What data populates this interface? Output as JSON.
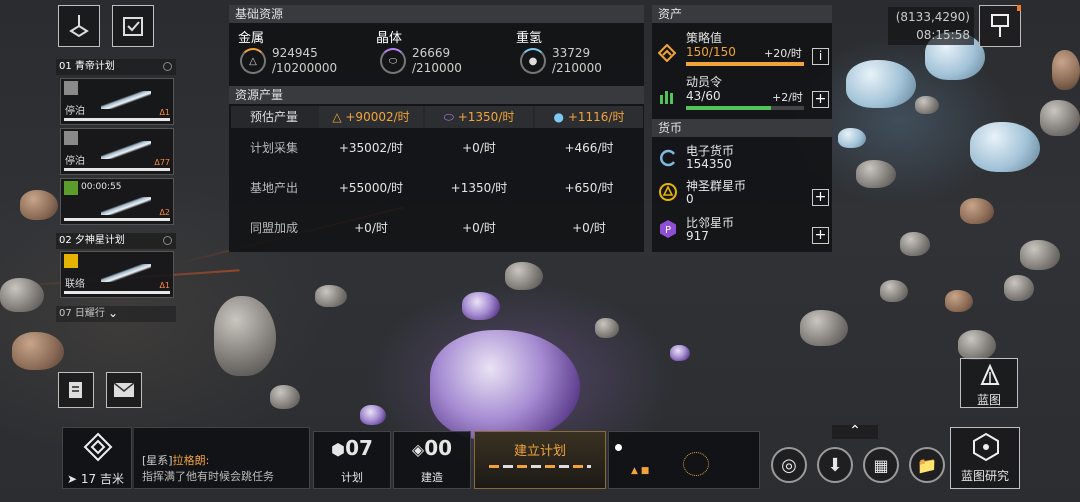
{
  "top_left": {
    "fleets": [
      {
        "index": "01",
        "name": "青帝计划"
      },
      {
        "index": "02",
        "name": "夕神星计划"
      },
      {
        "index": "07",
        "name": "日耀行"
      }
    ],
    "cards": [
      {
        "state": "停泊",
        "warn": "Δ1"
      },
      {
        "state": "停泊",
        "warn": "Δ77"
      },
      {
        "timer": "00:00:55",
        "warn": "Δ2"
      },
      {
        "state": "联络",
        "warn": "Δ1"
      }
    ]
  },
  "resources": {
    "header": "基础资源",
    "items": [
      {
        "name": "金属",
        "current": "924945",
        "max": "/10200000"
      },
      {
        "name": "晶体",
        "current": "26669",
        "max": "/210000"
      },
      {
        "name": "重氢",
        "current": "33729",
        "max": "/210000"
      }
    ]
  },
  "production": {
    "header": "资源产量",
    "rows": [
      {
        "label": "预估产量",
        "metal": "+90002/时",
        "crystal": "+1350/时",
        "deut": "+1116/时"
      },
      {
        "label": "计划采集",
        "metal": "+35002/时",
        "crystal": "+0/时",
        "deut": "+466/时"
      },
      {
        "label": "基地产出",
        "metal": "+55000/时",
        "crystal": "+1350/时",
        "deut": "+650/时"
      },
      {
        "label": "同盟加成",
        "metal": "+0/时",
        "crystal": "+0/时",
        "deut": "+0/时"
      }
    ]
  },
  "assets": {
    "header": "资产",
    "strategy": {
      "label": "策略值",
      "value": "150/150",
      "rate": "+20/时",
      "fill": 1.0
    },
    "mobilize": {
      "label": "动员令",
      "value": "43/60",
      "rate": "+2/时",
      "fill": 0.72
    },
    "info_icon": "i"
  },
  "currency": {
    "header": "货币",
    "items": [
      {
        "name": "电子货币",
        "value": "154350"
      },
      {
        "name": "神圣群星币",
        "value": "0"
      },
      {
        "name": "比邻星币",
        "value": "917"
      }
    ]
  },
  "top_right": {
    "coords": "(8133,4290)",
    "time": "08:15:58"
  },
  "blueprint": {
    "label": "蓝图"
  },
  "bottom": {
    "distance_value": "17",
    "distance_unit": "吉米",
    "chat_channel": "[星系]",
    "chat_sender": "拉格朗:",
    "chat_message": "指挥满了他有时候会跳任务",
    "plan_count": "07",
    "plan_label": "计划",
    "build_count": "00",
    "build_label": "建造",
    "build_plan_label": "建立计划",
    "research_label": "蓝图研究"
  },
  "colors": {
    "accent_orange": "#f2a43a",
    "accent_green": "#56c25a",
    "panel_bg": "#121315"
  }
}
